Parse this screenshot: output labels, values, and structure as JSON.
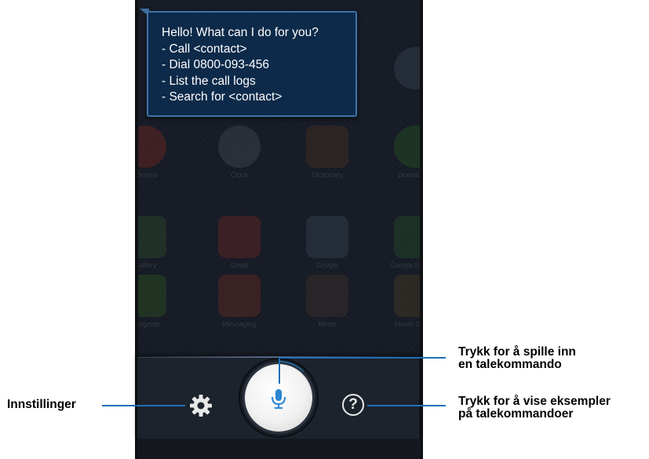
{
  "voice_bubble": {
    "lines": [
      "Hello! What can I do for you?",
      "- Call <contact>",
      "- Dial 0800-093-456",
      "- List the call logs",
      "- Search for <contact>"
    ]
  },
  "background_apps": [
    {
      "label": "",
      "color": "#5a6a7a",
      "icon": "browser-app-icon",
      "round": true
    },
    {
      "label": "Chrome",
      "color": "#c0392b",
      "icon": "chrome-app-icon",
      "round": true
    },
    {
      "label": "Clock",
      "color": "#6b7684",
      "icon": "clock-app-icon",
      "round": true
    },
    {
      "label": "Dictionary",
      "color": "#7a4a2a",
      "icon": "dictionary-app-icon",
      "round": false
    },
    {
      "label": "Downloads",
      "color": "#3a8a2a",
      "icon": "downloads-app-icon",
      "round": true
    },
    {
      "label": "Gallery",
      "color": "#4a7a3a",
      "icon": "gallery-app-icon",
      "round": false
    },
    {
      "label": "Gmail",
      "color": "#b03a2e",
      "icon": "gmail-app-icon",
      "round": false
    },
    {
      "label": "Google",
      "color": "#5a6a7a",
      "icon": "google-search-app-icon",
      "round": false
    },
    {
      "label": "Google Settings",
      "color": "#3a7a3a",
      "icon": "google-settings-app-icon",
      "round": false
    },
    {
      "label": "Hangouts",
      "color": "#4a8a2a",
      "icon": "hangouts-app-icon",
      "round": false
    },
    {
      "label": "Messaging",
      "color": "#b0402a",
      "icon": "messaging-app-icon",
      "round": false
    },
    {
      "label": "Mirror",
      "color": "#6a4a3a",
      "icon": "mirror-app-icon",
      "round": false
    },
    {
      "label": "Movie Studio",
      "color": "#7a5a2a",
      "icon": "movie-studio-app-icon",
      "round": false
    }
  ],
  "controls": {
    "settings_icon": "gear-icon",
    "mic_icon": "microphone-icon",
    "help_icon": "help-icon",
    "help_glyph": "?",
    "accent_color": "#1e6fb8"
  },
  "callouts": {
    "settings": "Innstillinger",
    "record_line1": "Trykk for å spille inn",
    "record_line2": "en talekommando",
    "examples_line1": "Trykk for å vise eksempler",
    "examples_line2": "på talekommandoer"
  }
}
